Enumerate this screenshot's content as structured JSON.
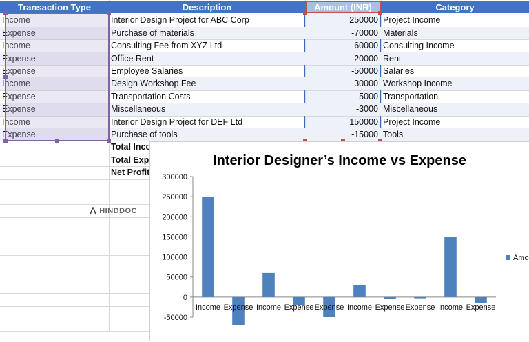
{
  "sheet": {
    "headers": [
      "Transaction Type",
      "Description",
      "Amount (INR)",
      "Category"
    ],
    "rows": [
      {
        "type": "Income",
        "description": "Interior Design Project for ABC Corp",
        "amount": "250000",
        "category": "Project Income"
      },
      {
        "type": "Expense",
        "description": "Purchase of materials",
        "amount": "-70000",
        "category": "Materials"
      },
      {
        "type": "Income",
        "description": "Consulting Fee from XYZ Ltd",
        "amount": "60000",
        "category": "Consulting Income"
      },
      {
        "type": "Expense",
        "description": "Office Rent",
        "amount": "-20000",
        "category": "Rent"
      },
      {
        "type": "Expense",
        "description": "Employee Salaries",
        "amount": "-50000",
        "category": "Salaries"
      },
      {
        "type": "Income",
        "description": "Design Workshop Fee",
        "amount": "30000",
        "category": "Workshop Income"
      },
      {
        "type": "Expense",
        "description": "Transportation Costs",
        "amount": "-5000",
        "category": "Transportation"
      },
      {
        "type": "Expense",
        "description": "Miscellaneous",
        "amount": "-3000",
        "category": "Miscellaneous"
      },
      {
        "type": "Income",
        "description": "Interior Design Project for DEF Ltd",
        "amount": "150000",
        "category": "Project Income"
      },
      {
        "type": "Expense",
        "description": "Purchase of tools",
        "amount": "-15000",
        "category": "Tools"
      }
    ],
    "summary_labels": [
      "Total Inco",
      "Total Expe",
      "Net Profit"
    ]
  },
  "watermark": {
    "logo": "⋀",
    "text": "HINDDOC"
  },
  "chart_data": {
    "type": "bar",
    "title": "Interior Designer’s Income vs Expense",
    "categories": [
      "Income",
      "Expense",
      "Income",
      "Expense",
      "Expense",
      "Income",
      "Expense",
      "Expense",
      "Income",
      "Expense"
    ],
    "series": [
      {
        "name": "Amo",
        "values": [
          250000,
          -70000,
          60000,
          -20000,
          -50000,
          30000,
          -5000,
          -3000,
          150000,
          -15000
        ]
      }
    ],
    "ylim": [
      -50000,
      300000
    ],
    "yticks": [
      300000,
      250000,
      200000,
      150000,
      100000,
      50000,
      0,
      -50000
    ],
    "grid": false,
    "legend": "right",
    "colors": {
      "bar": "#4f81bd"
    }
  }
}
